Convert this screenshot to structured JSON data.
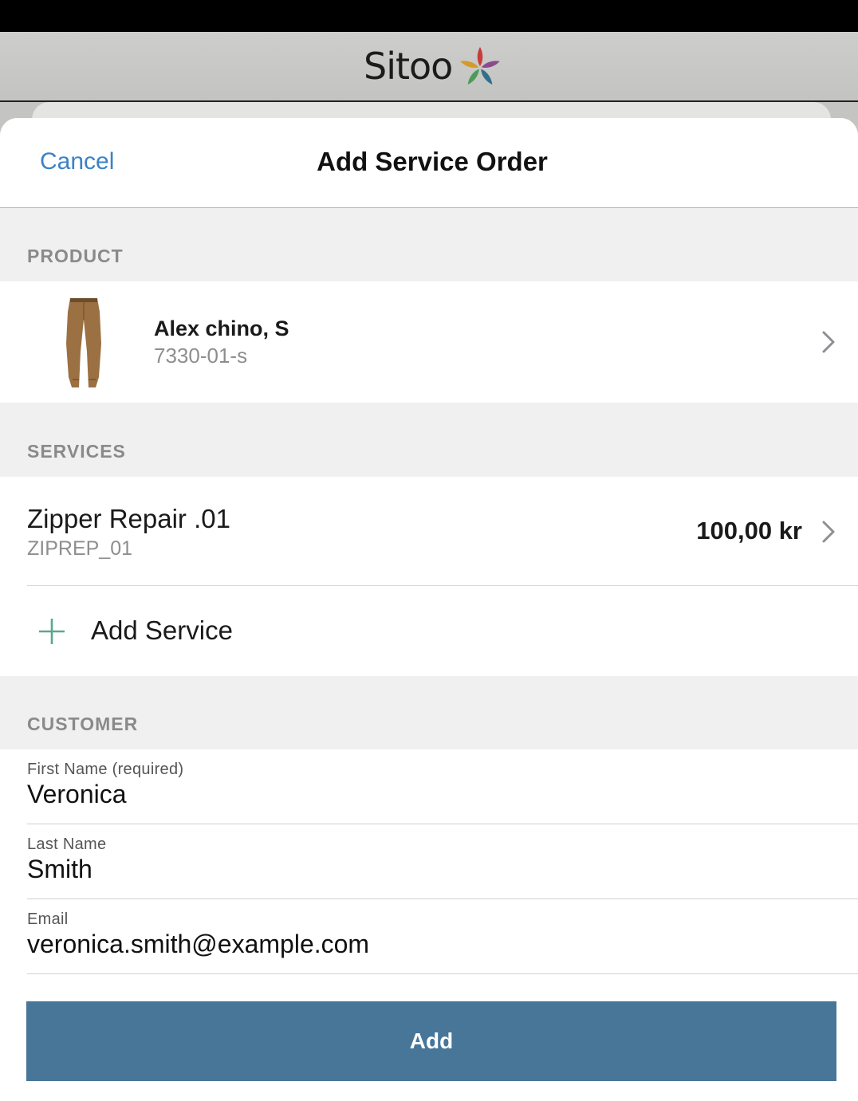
{
  "header": {
    "brand_name": "Sitoo",
    "logo_icon": "sitoo-star-logo-icon"
  },
  "sheet": {
    "cancel_label": "Cancel",
    "title": "Add Service Order"
  },
  "product_section": {
    "header": "PRODUCT",
    "product": {
      "name": "Alex chino, S",
      "sku": "7330-01-s",
      "thumbnail_icon": "chino-pants-icon"
    }
  },
  "services_section": {
    "header": "SERVICES",
    "services": [
      {
        "name": "Zipper Repair .01",
        "code": "ZIPREP_01",
        "price": "100,00 kr"
      }
    ],
    "add_service_label": "Add Service"
  },
  "customer_section": {
    "header": "CUSTOMER",
    "fields": {
      "first_name": {
        "label": "First Name (required)",
        "value": "Veronica"
      },
      "last_name": {
        "label": "Last Name",
        "value": "Smith"
      },
      "email": {
        "label": "Email",
        "value": "veronica.smith@example.com"
      }
    }
  },
  "footer": {
    "add_button_label": "Add"
  },
  "colors": {
    "accent_link": "#3b82c6",
    "primary_button": "#477699",
    "plus_icon": "#5aa88a"
  }
}
